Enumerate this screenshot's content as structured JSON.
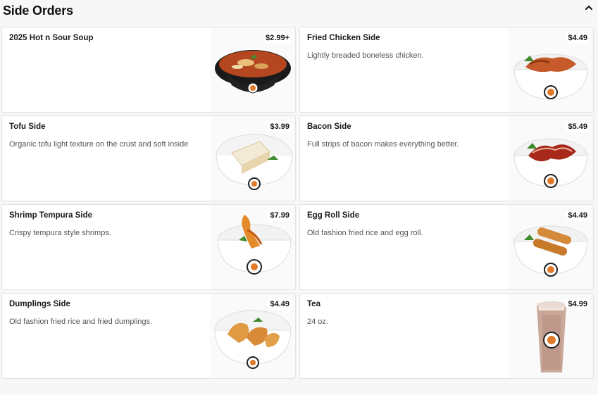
{
  "section": {
    "title": "Side Orders",
    "collapse_icon": "chevron-up-icon"
  },
  "items": [
    {
      "name": "2025 Hot n Sour Soup",
      "description": "",
      "price": "$2.99+",
      "image": "soup"
    },
    {
      "name": "Fried Chicken Side",
      "description": "Lightly breaded boneless chicken.",
      "price": "$4.49",
      "image": "chicken"
    },
    {
      "name": "Tofu Side",
      "description": "Organic tofu light texture on the crust and soft inside",
      "price": "$3.99",
      "image": "tofu"
    },
    {
      "name": "Bacon Side",
      "description": "Full strips of bacon makes everything better.",
      "price": "$5.49",
      "image": "bacon"
    },
    {
      "name": "Shrimp Tempura Side",
      "description": "Crispy tempura style shrimps.",
      "price": "$7.99",
      "image": "shrimp"
    },
    {
      "name": "Egg Roll Side",
      "description": "Old fashion fried rice and egg roll.",
      "price": "$4.49",
      "image": "eggroll"
    },
    {
      "name": "Dumplings Side",
      "description": "Old fashion fried rice and fried dumplings.",
      "price": "$4.49",
      "image": "dumplings"
    },
    {
      "name": "Tea",
      "description": "24 oz.",
      "price": "$4.99",
      "image": "tea"
    }
  ],
  "colors": {
    "background": "#f7f7f7",
    "card": "#ffffff",
    "border": "#e2e2e2",
    "text": "#191919",
    "muted": "#545454"
  }
}
